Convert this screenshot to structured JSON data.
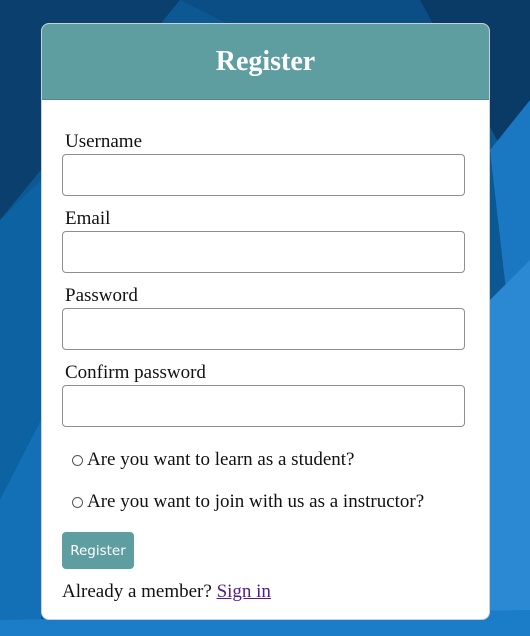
{
  "form": {
    "title": "Register",
    "fields": [
      {
        "label": "Username",
        "value": ""
      },
      {
        "label": "Email",
        "value": ""
      },
      {
        "label": "Password",
        "value": ""
      },
      {
        "label": "Confirm password",
        "value": ""
      }
    ],
    "roles": [
      {
        "label": "Are you want to learn as a student?",
        "selected": false
      },
      {
        "label": "Are you want to join with us as a instructor?",
        "selected": false
      }
    ],
    "submit_label": "Register",
    "footer_text": "Already a member?",
    "signin_link": "Sign in"
  },
  "colors": {
    "accent": "#5f9ea0",
    "link": "#551a8b",
    "background": "#0d5a92"
  }
}
